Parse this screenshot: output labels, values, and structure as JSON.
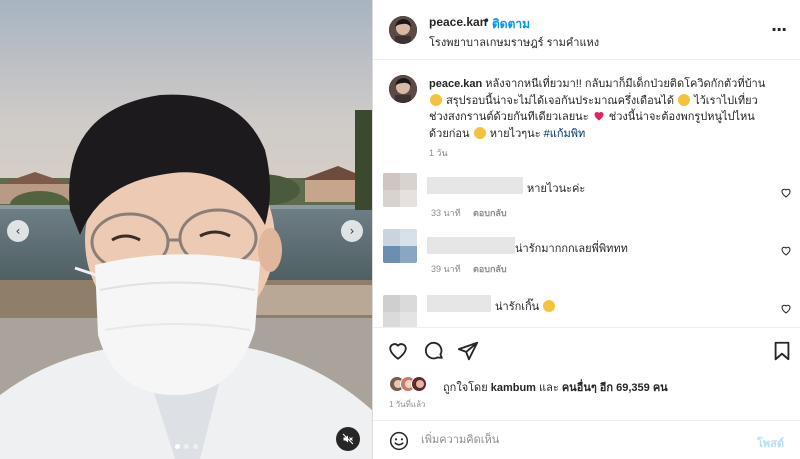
{
  "media": {
    "prev_icon": "chevron-left-icon",
    "next_icon": "chevron-right-icon",
    "mute_icon": "speaker-muted-icon",
    "carousel_count": 3,
    "carousel_active": 1
  },
  "header": {
    "username": "peace.kan",
    "separator": "•",
    "follow_label": "ติดตาม",
    "location": "โรงพยาบาลเกษมราษฎร์ รามคำแหง",
    "more_icon": "more-horizontal-icon"
  },
  "caption": {
    "username": "peace.kan",
    "text_1": "หลังจากหนีเที่ยวมา!! กลับมาก็มีเด็กป่วยติดโควิดกักตัวที่บ้าน",
    "text_2": "สรุปรอบนี้น่าจะไม่ได้เจอกันประมาณครึ่งเดือนได้",
    "text_3": "ไว้เราไปเที่ยวช่วงสงกรานต์ด้วยกันทีเดียวเลยนะ",
    "text_4": "ช่วงนี้น่าจะต้องพกรูปหนูไปไหนด้วยก่อน",
    "text_5": "หายไวๆนะ",
    "hashtag": "#แก้มพิท",
    "time": "1 วัน"
  },
  "comments": [
    {
      "text": "หายไวนะค่ะ",
      "time": "33 นาที",
      "reply": "ตอบกลับ"
    },
    {
      "text": "น่ารักมากกกเลยพี่พิททท",
      "time": "39 นาที",
      "reply": "ตอบกลับ"
    },
    {
      "text": "น่ารักเกิ๊น",
      "time": "",
      "reply": ""
    }
  ],
  "actions": {
    "like_icon": "heart-icon",
    "comment_icon": "comment-icon",
    "share_icon": "send-icon",
    "save_icon": "bookmark-icon"
  },
  "likes": {
    "prefix": "ถูกใจโดย",
    "user": "kambum",
    "middle": "และ",
    "others": "คนอื่นๆ อีก 69,359 คน"
  },
  "post_time": "1 วันที่แล้ว",
  "composer": {
    "emoji_icon": "smile-icon",
    "placeholder": "เพิ่มความคิดเห็น",
    "post_label": "โพสต์"
  },
  "colors": {
    "link_blue": "#0095f6",
    "hashtag": "#00376b",
    "secondary_text": "#8e8e8e",
    "post_disabled": "#b2dffc",
    "border": "#dbdbdb"
  }
}
